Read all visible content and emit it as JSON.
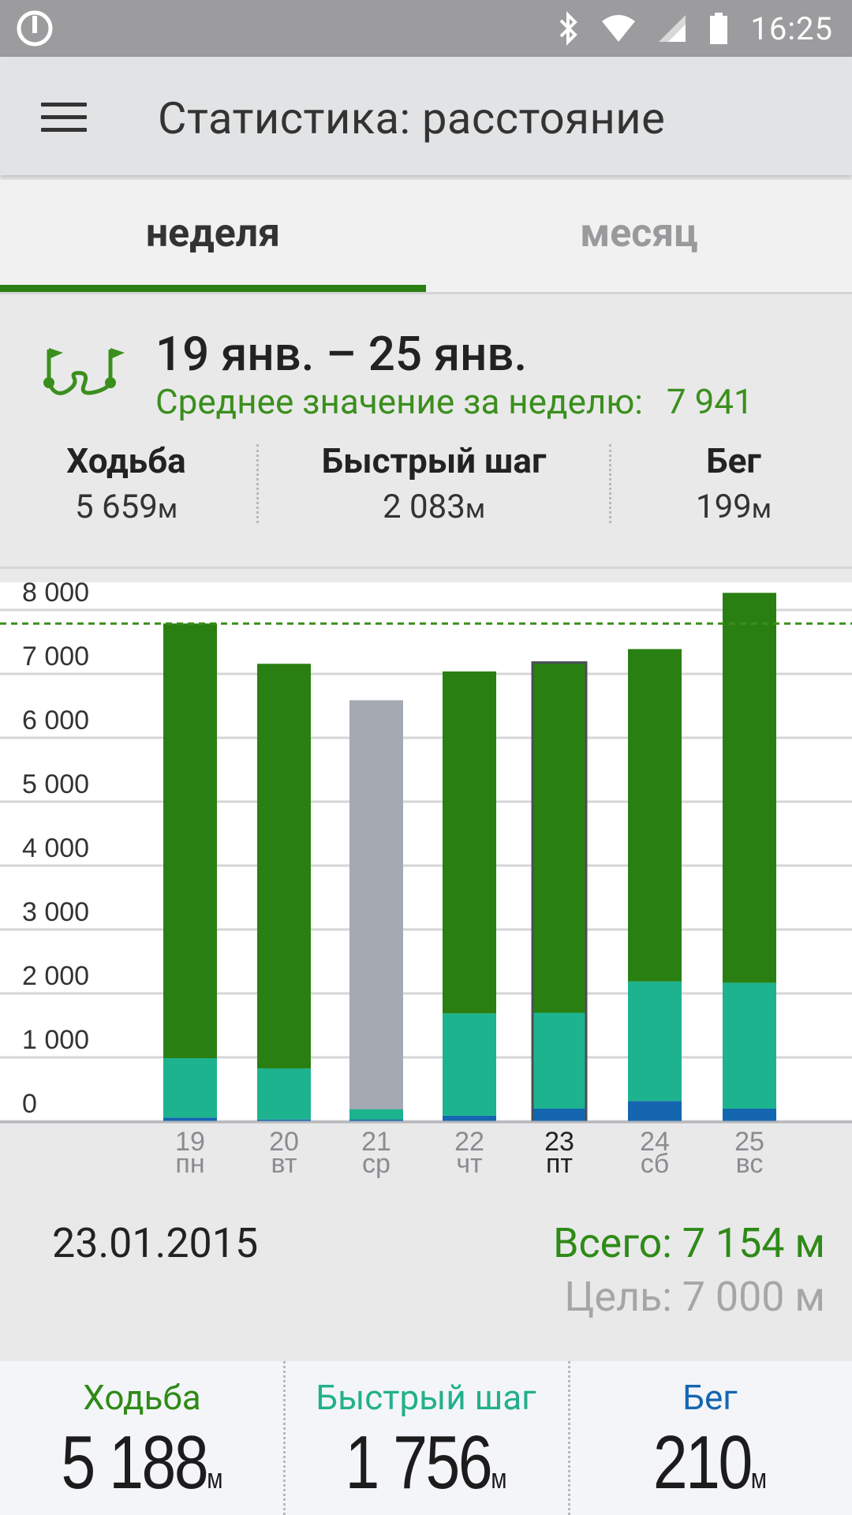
{
  "status_bar": {
    "time": "16:25"
  },
  "toolbar": {
    "title": "Статистика: расстояние"
  },
  "tabs": [
    {
      "label": "неделя",
      "active": true
    },
    {
      "label": "месяц",
      "active": false
    }
  ],
  "summary": {
    "range": "19 янв. – 25 янв.",
    "avg_label": "Среднее значение за неделю:",
    "avg_value": "7 941",
    "columns": [
      {
        "label": "Ходьба",
        "value": "5 659",
        "unit": "м"
      },
      {
        "label": "Быстрый шаг",
        "value": "2 083",
        "unit": "м"
      },
      {
        "label": "Бег",
        "value": "199",
        "unit": "м"
      }
    ]
  },
  "chart_data": {
    "type": "bar",
    "stacked": true,
    "categories": [
      "19",
      "20",
      "21",
      "22",
      "23",
      "24",
      "25"
    ],
    "sublabels": [
      "пн",
      "вт",
      "ср",
      "чт",
      "пт",
      "сб",
      "вс"
    ],
    "ylim": [
      0,
      8000
    ],
    "yticks": [
      "0",
      "1 000",
      "2 000",
      "3 000",
      "4 000",
      "5 000",
      "6 000",
      "7 000",
      "8 000"
    ],
    "goal_line": 7800,
    "selected_index": 4,
    "inactive_index": 2,
    "inactive_total": 6600,
    "series": [
      {
        "name": "Бег",
        "color": "#1566b0",
        "values": [
          70,
          40,
          40,
          100,
          210,
          330,
          210
        ]
      },
      {
        "name": "Быстрый шаг",
        "color": "#1db38e",
        "values": [
          930,
          800,
          160,
          1600,
          1500,
          1870,
          1970
        ]
      },
      {
        "name": "Ходьба",
        "color": "#2a7f12",
        "values": [
          6800,
          6330,
          0,
          5350,
          5480,
          5200,
          6100
        ]
      }
    ],
    "inactive_color": "#a5a9b2",
    "grid": true
  },
  "details": {
    "date": "23.01.2015",
    "total": "Всего: 7 154 м",
    "goal": "Цель: 7 000 м"
  },
  "breakdown": [
    {
      "label": "Ходьба",
      "value": "5 188",
      "unit": "м"
    },
    {
      "label": "Быстрый шаг",
      "value": "1 756",
      "unit": "м"
    },
    {
      "label": "Бег",
      "value": "210",
      "unit": "м"
    }
  ],
  "colors": {
    "walk": "#2a7f12",
    "brisk": "#1db38e",
    "run": "#1566b0",
    "accent": "#2a7f12"
  }
}
